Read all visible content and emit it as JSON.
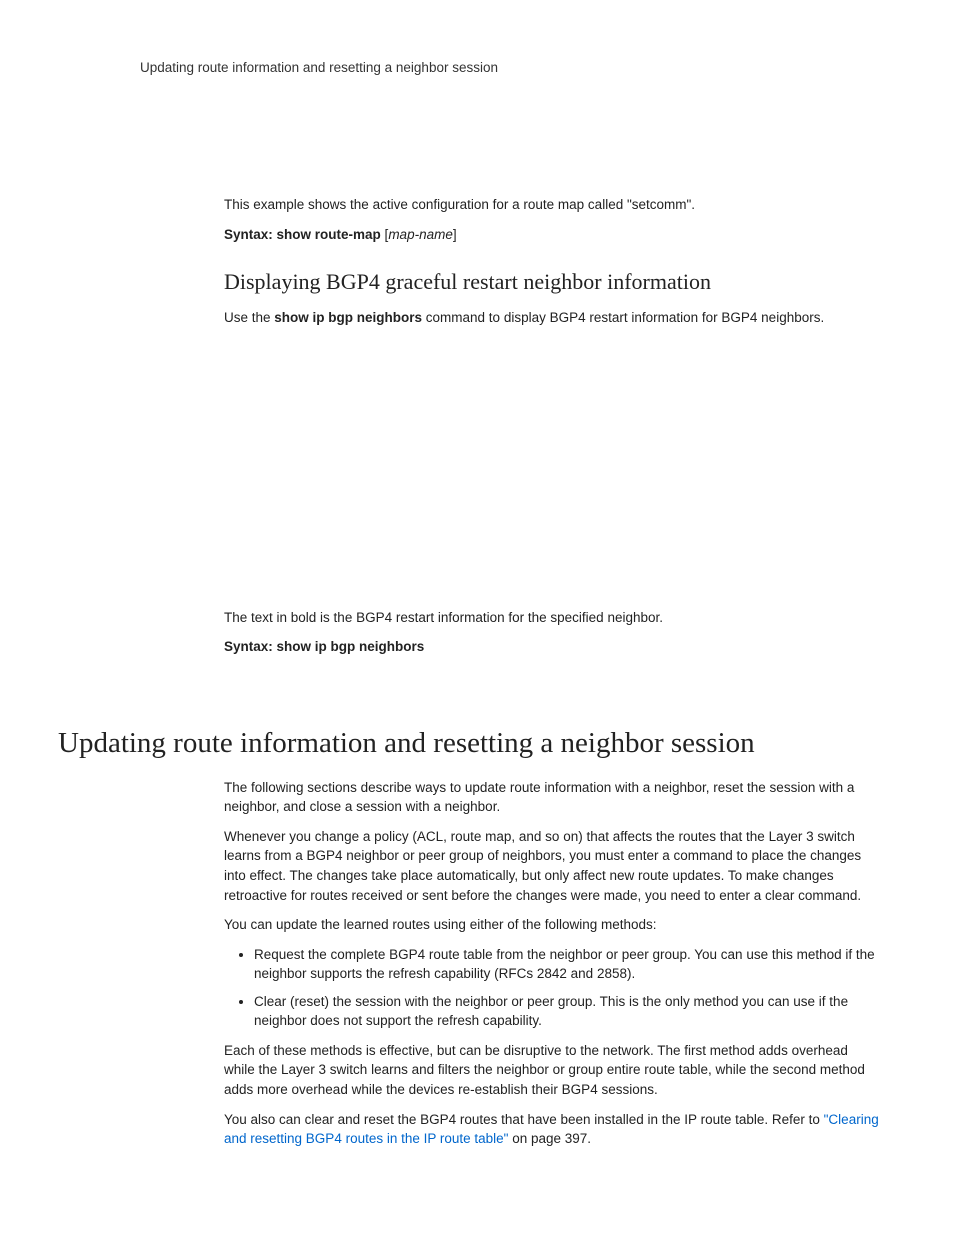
{
  "runningHeader": "Updating route information and resetting a neighbor session",
  "intro": {
    "p1_a": "This example shows the active configuration for a route map called ",
    "p1_b": "\"setcomm\".",
    "syntax_label": "Syntax:  ",
    "syntax_cmd": "show route-map",
    "syntax_after": " [",
    "syntax_param": "map-name",
    "syntax_close": "]"
  },
  "section_graceful": {
    "heading": "Displaying BGP4 graceful restart neighbor information",
    "p_a": "Use the ",
    "p_bold": "show ip bgp neighbors",
    "p_b": " command to display BGP4 restart information for BGP4 neighbors.",
    "after1": "The text in bold is the BGP4 restart information for the specified neighbor.",
    "syntax_label": "Syntax:  ",
    "syntax_cmd": "show ip bgp neighbors"
  },
  "section_update": {
    "heading": "Updating route information and resetting a neighbor session",
    "p1": "The following sections describe ways to update route information with a neighbor, reset the session with a neighbor, and close a session with a neighbor.",
    "p2": "Whenever you change a policy (ACL, route map, and so on) that affects the routes that the Layer 3 switch learns from a BGP4 neighbor or peer group of neighbors, you must enter a command to place the changes into effect. The changes take place automatically, but only affect new route updates. To make changes retroactive for routes received or sent before the changes were made, you need to enter a clear command.",
    "p3": "You can update the learned routes using either of the following methods:",
    "bullets": [
      "Request the complete BGP4 route table from the neighbor or peer group. You can use this method if the neighbor supports the refresh capability (RFCs 2842 and 2858).",
      "Clear (reset) the session with the neighbor or peer group. This is the only method you can use if the neighbor does not support the refresh capability."
    ],
    "p4": "Each of these methods is effective, but can be disruptive to the network. The first method adds overhead while the Layer 3 switch learns and filters the neighbor or group entire route table, while the second method adds more overhead while the devices re-establish their BGP4 sessions.",
    "p5_a": "You also can clear and reset the BGP4 routes that have been installed in the IP route table. Refer to ",
    "p5_link": "\"Clearing and resetting BGP4 routes in the IP route table\"",
    "p5_b": " on page 397."
  }
}
